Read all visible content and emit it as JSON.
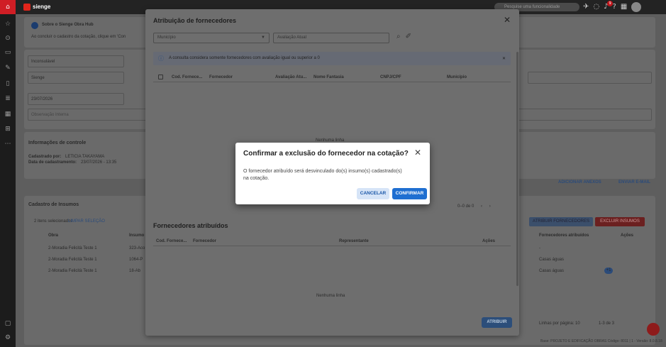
{
  "app": {
    "brand": "sienge",
    "search_placeholder": "Pesquise uma funcionalidade",
    "notif_count": "9"
  },
  "background": {
    "banner_title": "Sobre o Sienge Obra Hub",
    "banner_text": "Ao concluir o cadastro da cotação, clique em 'Con",
    "field1_label": "Condições de entrega",
    "field1_value": "Inconsulável",
    "field2_label": "Solicitado por",
    "field2_value": "Sienge",
    "field3_label": "Data de vencimento",
    "field3_value": "23/07/2026",
    "obs_label": "Observação Interna",
    "control_title": "Informações de controle",
    "created_by_label": "Cadastrado por:",
    "created_by_value": "LETICIA TAKAYAMA",
    "created_date_label": "Data de cadastramento:",
    "created_date_value": "23/07/2026 - 13:35",
    "add_attach": "ADICIONAR ANEXOS",
    "send_email": "ENVIAR E-MAIL",
    "insumos_title": "Cadastro de Insumos",
    "selected_text": "2 itens selecionados",
    "clear_sel": "LIMPAR SELEÇÃO",
    "assign_btn": "ATRIBUIR FORNECEDORES",
    "delete_btn": "EXCLUIR INSUMOS",
    "col_obra": "Obra",
    "col_insumo": "Insumo",
    "col_forn": "Fornecedores atribuídos",
    "col_acoes": "Ações",
    "rows": [
      {
        "obra": "2-Moradia Felicità Teste 1",
        "insumo": "323-Aco",
        "forn": "-"
      },
      {
        "obra": "2-Moradia Felicità Teste 1",
        "insumo": "1064-P",
        "forn": "Casas águas"
      },
      {
        "obra": "2-Moradia Felicità Teste 1",
        "insumo": "18-Ab",
        "forn": "Casas águas",
        "badge": "+1"
      }
    ],
    "rows_per_page": "Linhas por página: 10",
    "range": "1-3 de 3",
    "footer": "Base: PROJETO E EDIFICAÇÃO OBRAS   Código: 8011 | 1 - Versão: 8.0.8.18"
  },
  "modal": {
    "title": "Atribuição de fornecedores",
    "municipio_placeholder": "Município",
    "avaliacao_placeholder": "Avaliação Atual",
    "alert_text": "A consulta considera somente fornecedores com avaliação igual ou superior a 0",
    "cols1": [
      "Cod. Fornece...",
      "Fornecedor",
      "Avaliação Atu...",
      "Nome Fantasia",
      "CNPJ/CPF",
      "Município"
    ],
    "empty1": "Nenhuma linha",
    "pager": "0–0 de 0",
    "section2_title": "Fornecedores atribuídos",
    "cols2": [
      "Cod. Fornece...",
      "Fornecedor",
      "Representante",
      "Ações"
    ],
    "empty2": "Nenhuma linha",
    "atribuir": "ATRIBUIR"
  },
  "dialog": {
    "title": "Confirmar a exclusão do fornecedor na cotação?",
    "body": "O fornecedor atribuído será desvinculado do(s) insumo(s) cadastrado(s) na cotação.",
    "cancel": "CANCELAR",
    "confirm": "CONFIRMAR"
  }
}
